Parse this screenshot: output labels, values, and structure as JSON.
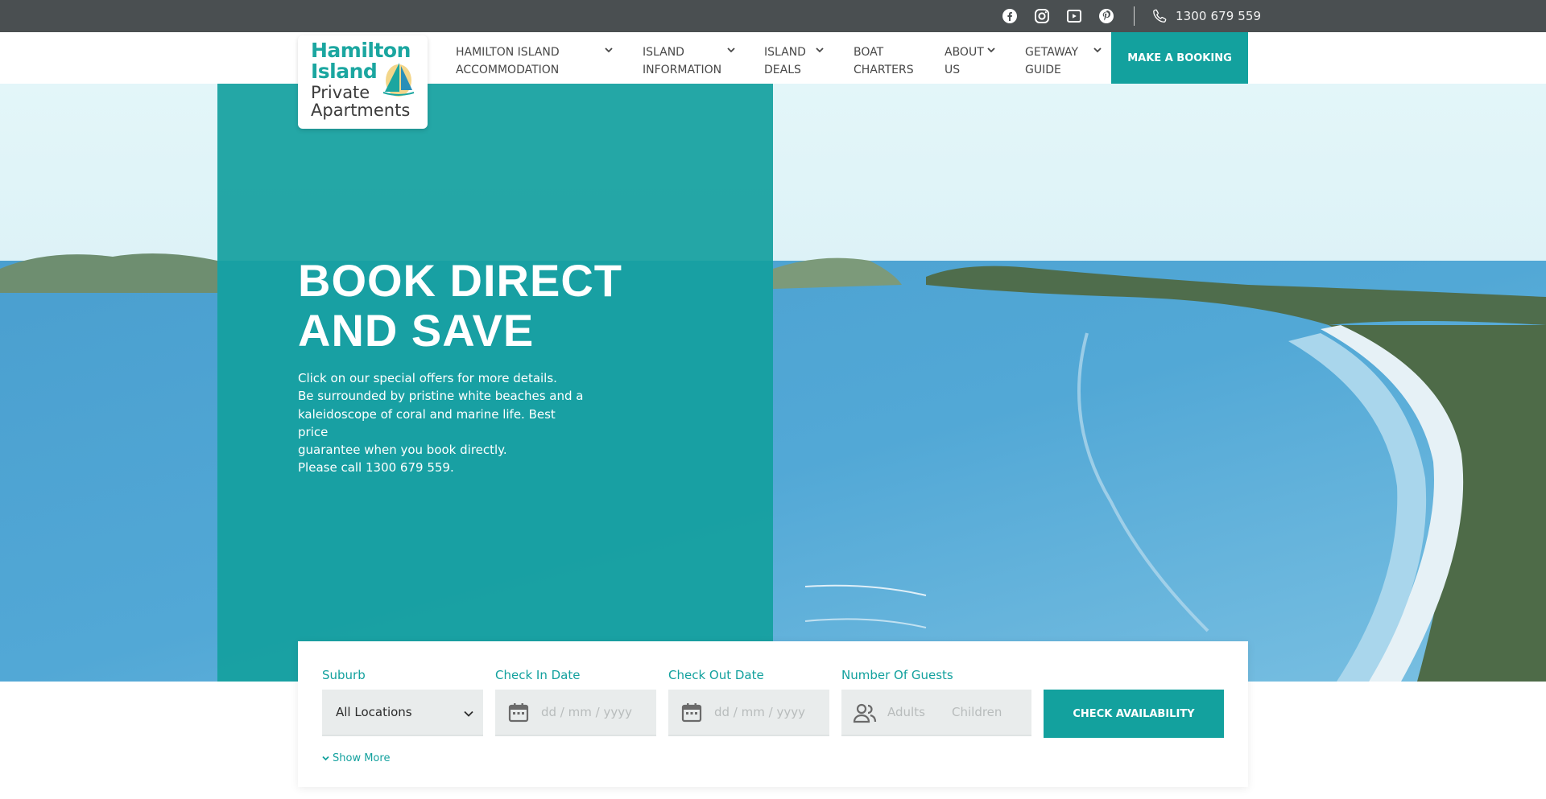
{
  "topbar": {
    "social": [
      "facebook-icon",
      "instagram-icon",
      "youtube-icon",
      "pinterest-icon"
    ],
    "phone": "1300 679 559"
  },
  "logo": {
    "line1": "Hamilton",
    "line2": "Island",
    "line3": "Private",
    "line4": "Apartments"
  },
  "nav": {
    "items": [
      {
        "line1": "HAMILTON ISLAND",
        "line2": "ACCOMMODATION",
        "dropdown": true
      },
      {
        "line1": "ISLAND",
        "line2": "INFORMATION",
        "dropdown": true
      },
      {
        "line1": "ISLAND",
        "line2": "DEALS",
        "dropdown": true
      },
      {
        "line1": "BOAT",
        "line2": "CHARTERS",
        "dropdown": false
      },
      {
        "line1": "ABOUT",
        "line2": "US",
        "dropdown": true
      },
      {
        "line1": "GETAWAY",
        "line2": "GUIDE",
        "dropdown": true
      }
    ],
    "cta": "MAKE A BOOKING"
  },
  "hero": {
    "title_line1": "BOOK DIRECT",
    "title_line2": "AND SAVE",
    "text_lines": [
      "Click on our special offers for more details.",
      "Be surrounded by pristine white beaches and a",
      "kaleidoscope of coral and marine life. Best price",
      "guarantee when you book directly.",
      "Please call 1300 679 559."
    ]
  },
  "search": {
    "suburb_label": "Suburb",
    "suburb_value": "All Locations",
    "checkin_label": "Check In Date",
    "checkin_placeholder": "dd / mm / yyyy",
    "checkout_label": "Check Out Date",
    "checkout_placeholder": "dd / mm / yyyy",
    "guests_label": "Number Of Guests",
    "adults_placeholder": "Adults",
    "children_placeholder": "Children",
    "button": "CHECK AVAILABILITY",
    "show_more": "Show More"
  },
  "colors": {
    "teal": "#13a19e",
    "topbar": "#4a4f51"
  }
}
